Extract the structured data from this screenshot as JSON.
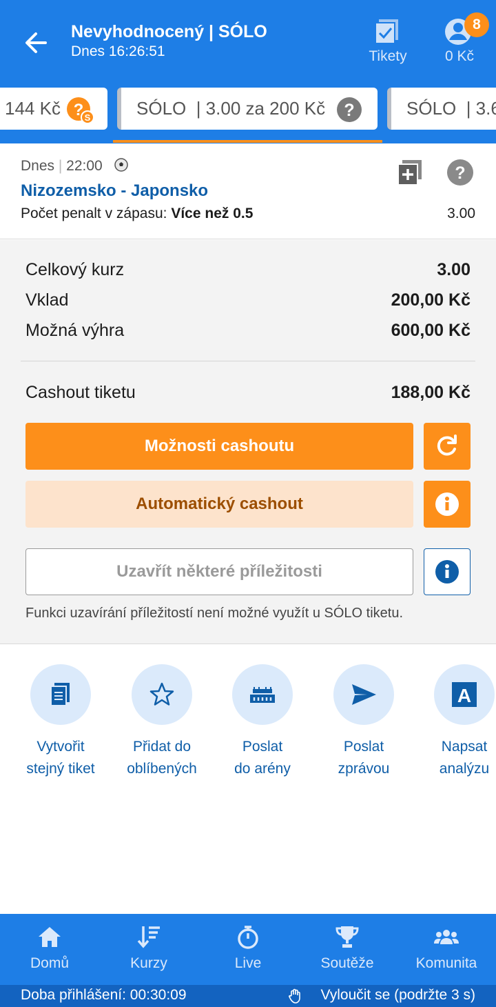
{
  "header": {
    "title": "Nevyhodnocený | SÓLO",
    "subtitle": "Dnes 16:26:51",
    "tickets_label": "Tikety",
    "balance": "0 Kč",
    "notification_count": "8"
  },
  "tabs": [
    {
      "label": "144 Kč"
    },
    {
      "label": "SÓLO  | 3.00 za 200 Kč"
    },
    {
      "label": "SÓLO  | 3.6"
    }
  ],
  "event": {
    "date": "Dnes",
    "time": "22:00",
    "match": "Nizozemsko - Japonsko",
    "market_label": "Počet penalt v zápasu:",
    "selection": "Více než 0.5",
    "odds": "3.00"
  },
  "summary": {
    "total_odds_label": "Celkový kurz",
    "total_odds_value": "3.00",
    "stake_label": "Vklad",
    "stake_value": "200,00 Kč",
    "win_label": "Možná výhra",
    "win_value": "600,00 Kč",
    "cashout_label": "Cashout tiketu",
    "cashout_value": "188,00 Kč"
  },
  "buttons": {
    "cashout_options": "Možnosti cashoutu",
    "auto_cashout": "Automatický cashout",
    "close_some": "Uzavřít některé příležitosti",
    "note": "Funkci uzavírání příležitostí není možné využít u SÓLO tiketu."
  },
  "actions": [
    {
      "line1": "Vytvořit",
      "line2": "stejný tiket"
    },
    {
      "line1": "Přidat do",
      "line2": "oblíbených"
    },
    {
      "line1": "Poslat",
      "line2": "do arény"
    },
    {
      "line1": "Poslat",
      "line2": "zprávou"
    },
    {
      "line1": "Napsat",
      "line2": "analýzu"
    }
  ],
  "nav": [
    {
      "label": "Domů"
    },
    {
      "label": "Kurzy"
    },
    {
      "label": "Live"
    },
    {
      "label": "Soutěže"
    },
    {
      "label": "Komunita"
    }
  ],
  "status_bar": {
    "session": "Doba přihlášení: 00:30:09",
    "exclude": "Vyloučit se (podržte 3 s)"
  },
  "colors": {
    "primary_blue": "#1e7ee6",
    "accent_orange": "#fd8f1a",
    "link_blue": "#0f5ea8"
  }
}
